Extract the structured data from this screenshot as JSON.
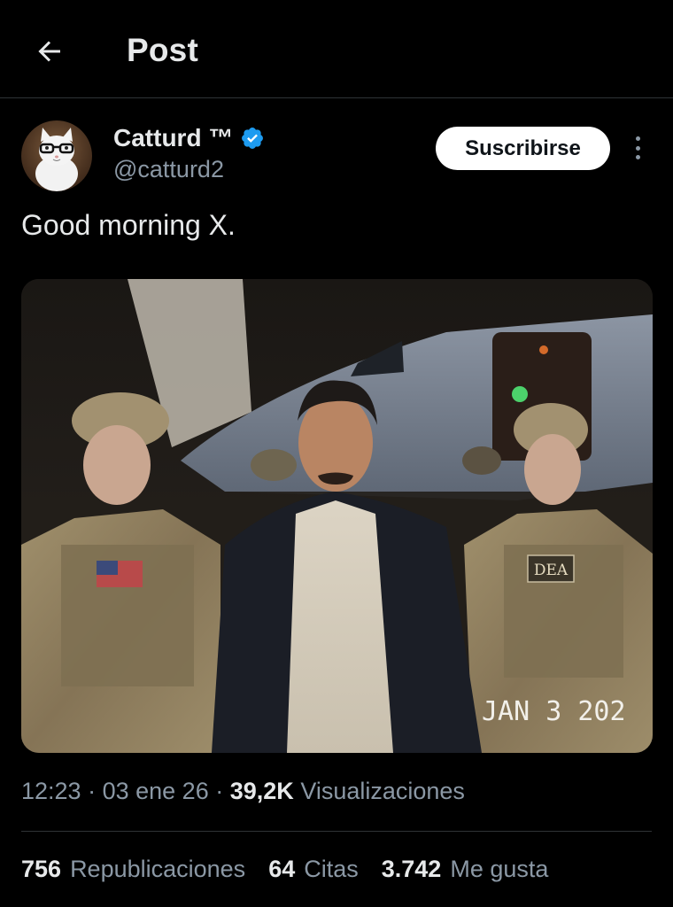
{
  "header": {
    "title": "Post",
    "back_icon": "arrow-left-icon"
  },
  "author": {
    "name": "Catturd ™",
    "handle": "@catturd2",
    "verified_color": "#1d9bf0",
    "avatar_icon": "cat-with-glasses-avatar"
  },
  "actions": {
    "subscribe_label": "Suscribirse",
    "more_icon": "more-vertical-icon"
  },
  "post": {
    "text": "Good morning X.",
    "media": {
      "overlay_text": "JAN  3 202",
      "patch_text": "DEA"
    }
  },
  "meta": {
    "time": "12:23",
    "date": "03 ene 26",
    "views_count": "39,2K",
    "views_label": "Visualizaciones"
  },
  "stats": {
    "reposts_count": "756",
    "reposts_label": "Republicaciones",
    "quotes_count": "64",
    "quotes_label": "Citas",
    "likes_count": "3.742",
    "likes_label": "Me gusta"
  },
  "colors": {
    "background": "#000000",
    "text_primary": "#e7e9ea",
    "text_secondary": "#8b98a5",
    "divider": "#2f3336"
  }
}
